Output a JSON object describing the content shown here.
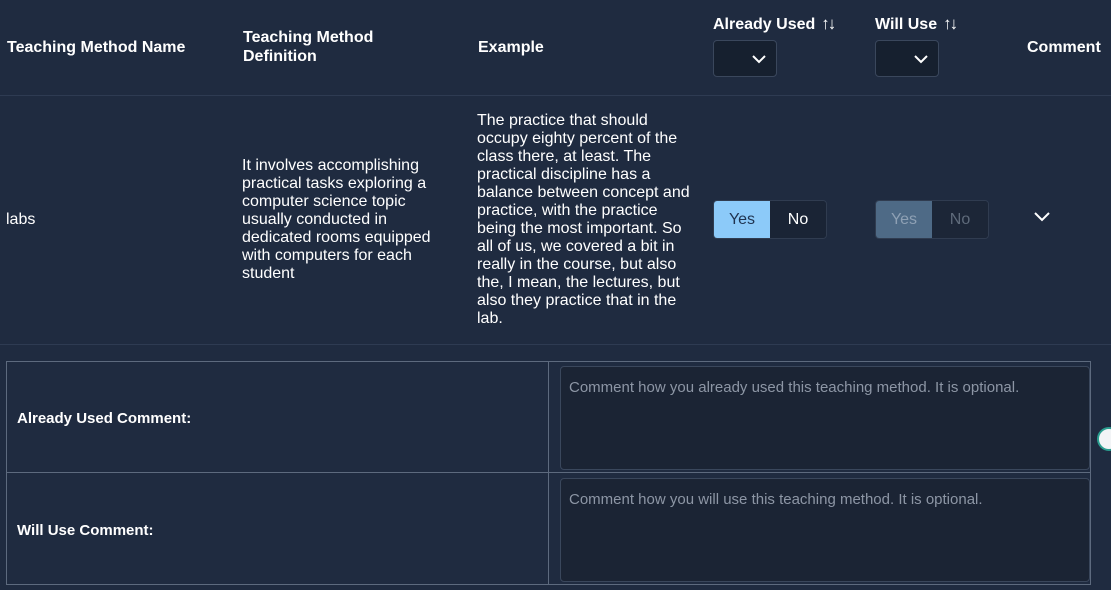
{
  "header": {
    "name": "Teaching Method Name",
    "definition": "Teaching Method Definition",
    "example": "Example",
    "already_used": "Already Used",
    "will_use": "Will Use",
    "comment": "Comment",
    "sort_icon": "↑↓",
    "already_used_filter": "",
    "will_use_filter": ""
  },
  "row": {
    "name": "labs",
    "definition": "It involves accomplishing practical tasks exploring a computer science topic usually conducted in dedicated rooms equipped with computers for each student",
    "example": "The practice that should occupy eighty percent of the class there, at least. The practical discipline has a balance between concept and practice, with the practice being the most important. So all of us, we covered a bit in really in the course, but also the, I mean, the lectures, but also they practice that in the lab.",
    "already_used": {
      "yes": "Yes",
      "no": "No",
      "selected": "Yes"
    },
    "will_use": {
      "yes": "Yes",
      "no": "No",
      "disabled": true
    }
  },
  "comments": {
    "already_used_label": "Already Used Comment:",
    "already_used_placeholder": "Comment how you already used this teaching method. It is optional.",
    "will_use_label": "Will Use Comment:",
    "will_use_placeholder": "Comment how you will use this teaching method. It is optional."
  },
  "colors": {
    "background": "#1f2b40",
    "selected_yes": "#8ccaf9",
    "disabled_yes": "#4e6a86"
  }
}
